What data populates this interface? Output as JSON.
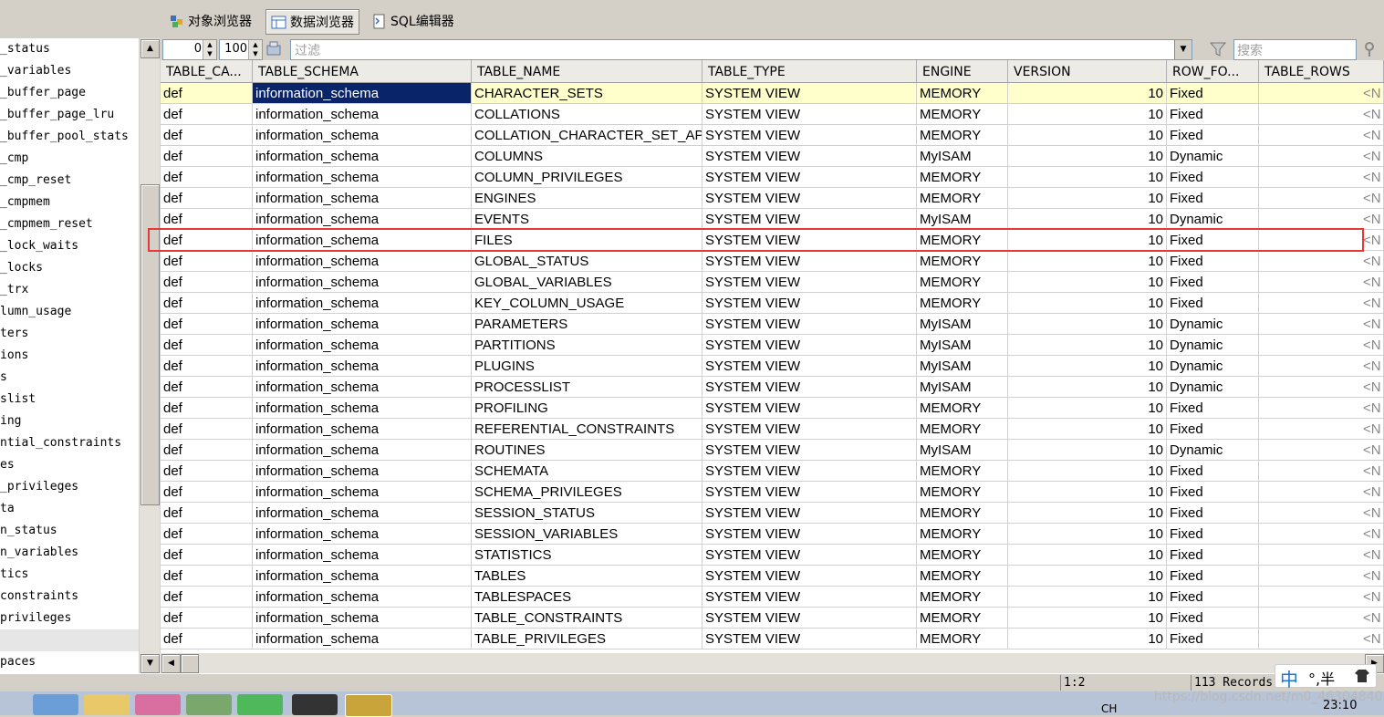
{
  "tabs": [
    {
      "label": "对象浏览器",
      "icon": "object-browser-icon"
    },
    {
      "label": "数据浏览器",
      "icon": "data-browser-icon"
    },
    {
      "label": "SQL编辑器",
      "icon": "sql-editor-icon"
    }
  ],
  "tree": [
    "_status",
    "_variables",
    "_buffer_page",
    "_buffer_page_lru",
    "_buffer_pool_stats",
    "_cmp",
    "_cmp_reset",
    "_cmpmem",
    "_cmpmem_reset",
    "_lock_waits",
    "_locks",
    "_trx",
    "lumn_usage",
    "ters",
    "ions",
    "s",
    "slist",
    "ing",
    "ntial_constraints",
    "es",
    "_privileges",
    "ta",
    "n_status",
    "n_variables",
    "tics",
    "constraints",
    "privileges",
    "",
    "paces"
  ],
  "toolbar": {
    "offset": "0",
    "limit": "100",
    "filter_placeholder": "过滤",
    "search_placeholder": "搜索"
  },
  "columns": [
    "TABLE_CA...",
    "TABLE_SCHEMA",
    "TABLE_NAME",
    "TABLE_TYPE",
    "ENGINE",
    "VERSION",
    "ROW_FO...",
    "TABLE_ROWS"
  ],
  "rows": [
    [
      "def",
      "information_schema",
      "CHARACTER_SETS",
      "SYSTEM VIEW",
      "MEMORY",
      "10",
      "Fixed",
      "<N"
    ],
    [
      "def",
      "information_schema",
      "COLLATIONS",
      "SYSTEM VIEW",
      "MEMORY",
      "10",
      "Fixed",
      "<N"
    ],
    [
      "def",
      "information_schema",
      "COLLATION_CHARACTER_SET_AP",
      "SYSTEM VIEW",
      "MEMORY",
      "10",
      "Fixed",
      "<N"
    ],
    [
      "def",
      "information_schema",
      "COLUMNS",
      "SYSTEM VIEW",
      "MyISAM",
      "10",
      "Dynamic",
      "<N"
    ],
    [
      "def",
      "information_schema",
      "COLUMN_PRIVILEGES",
      "SYSTEM VIEW",
      "MEMORY",
      "10",
      "Fixed",
      "<N"
    ],
    [
      "def",
      "information_schema",
      "ENGINES",
      "SYSTEM VIEW",
      "MEMORY",
      "10",
      "Fixed",
      "<N"
    ],
    [
      "def",
      "information_schema",
      "EVENTS",
      "SYSTEM VIEW",
      "MyISAM",
      "10",
      "Dynamic",
      "<N"
    ],
    [
      "def",
      "information_schema",
      "FILES",
      "SYSTEM VIEW",
      "MEMORY",
      "10",
      "Fixed",
      "<N"
    ],
    [
      "def",
      "information_schema",
      "GLOBAL_STATUS",
      "SYSTEM VIEW",
      "MEMORY",
      "10",
      "Fixed",
      "<N"
    ],
    [
      "def",
      "information_schema",
      "GLOBAL_VARIABLES",
      "SYSTEM VIEW",
      "MEMORY",
      "10",
      "Fixed",
      "<N"
    ],
    [
      "def",
      "information_schema",
      "KEY_COLUMN_USAGE",
      "SYSTEM VIEW",
      "MEMORY",
      "10",
      "Fixed",
      "<N"
    ],
    [
      "def",
      "information_schema",
      "PARAMETERS",
      "SYSTEM VIEW",
      "MyISAM",
      "10",
      "Dynamic",
      "<N"
    ],
    [
      "def",
      "information_schema",
      "PARTITIONS",
      "SYSTEM VIEW",
      "MyISAM",
      "10",
      "Dynamic",
      "<N"
    ],
    [
      "def",
      "information_schema",
      "PLUGINS",
      "SYSTEM VIEW",
      "MyISAM",
      "10",
      "Dynamic",
      "<N"
    ],
    [
      "def",
      "information_schema",
      "PROCESSLIST",
      "SYSTEM VIEW",
      "MyISAM",
      "10",
      "Dynamic",
      "<N"
    ],
    [
      "def",
      "information_schema",
      "PROFILING",
      "SYSTEM VIEW",
      "MEMORY",
      "10",
      "Fixed",
      "<N"
    ],
    [
      "def",
      "information_schema",
      "REFERENTIAL_CONSTRAINTS",
      "SYSTEM VIEW",
      "MEMORY",
      "10",
      "Fixed",
      "<N"
    ],
    [
      "def",
      "information_schema",
      "ROUTINES",
      "SYSTEM VIEW",
      "MyISAM",
      "10",
      "Dynamic",
      "<N"
    ],
    [
      "def",
      "information_schema",
      "SCHEMATA",
      "SYSTEM VIEW",
      "MEMORY",
      "10",
      "Fixed",
      "<N"
    ],
    [
      "def",
      "information_schema",
      "SCHEMA_PRIVILEGES",
      "SYSTEM VIEW",
      "MEMORY",
      "10",
      "Fixed",
      "<N"
    ],
    [
      "def",
      "information_schema",
      "SESSION_STATUS",
      "SYSTEM VIEW",
      "MEMORY",
      "10",
      "Fixed",
      "<N"
    ],
    [
      "def",
      "information_schema",
      "SESSION_VARIABLES",
      "SYSTEM VIEW",
      "MEMORY",
      "10",
      "Fixed",
      "<N"
    ],
    [
      "def",
      "information_schema",
      "STATISTICS",
      "SYSTEM VIEW",
      "MEMORY",
      "10",
      "Fixed",
      "<N"
    ],
    [
      "def",
      "information_schema",
      "TABLES",
      "SYSTEM VIEW",
      "MEMORY",
      "10",
      "Fixed",
      "<N"
    ],
    [
      "def",
      "information_schema",
      "TABLESPACES",
      "SYSTEM VIEW",
      "MEMORY",
      "10",
      "Fixed",
      "<N"
    ],
    [
      "def",
      "information_schema",
      "TABLE_CONSTRAINTS",
      "SYSTEM VIEW",
      "MEMORY",
      "10",
      "Fixed",
      "<N"
    ],
    [
      "def",
      "information_schema",
      "TABLE_PRIVILEGES",
      "SYSTEM VIEW",
      "MEMORY",
      "10",
      "Fixed",
      "<N"
    ]
  ],
  "status": {
    "position": "1:2",
    "records": "113 Records"
  },
  "ime": {
    "label": "中",
    "mode": "°,半"
  },
  "clock": "23:10",
  "tray_lang": "CH",
  "watermark": "https://blog.csdn.net/m0_46304840",
  "colors": {
    "selected_row": "#ffffcc",
    "focus_cell": "#0a246a",
    "highlight_box": "#e53935"
  }
}
